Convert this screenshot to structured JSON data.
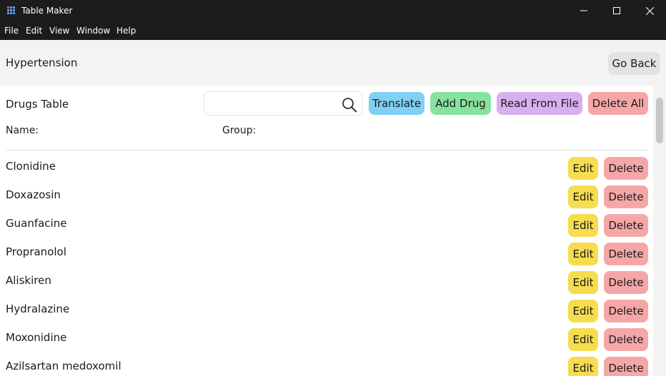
{
  "window": {
    "title": "Table Maker",
    "controls": {
      "minimize_icon": "minimize-icon",
      "maximize_icon": "maximize-icon",
      "close_icon": "close-icon"
    }
  },
  "menu": {
    "items": [
      "File",
      "Edit",
      "View",
      "Window",
      "Help"
    ]
  },
  "header": {
    "title": "Hypertension",
    "go_back_label": "Go Back"
  },
  "table": {
    "title": "Drugs Table",
    "search": {
      "value": "",
      "placeholder": "",
      "icon": "search-icon"
    },
    "actions": {
      "translate": "Translate",
      "add_drug": "Add Drug",
      "read_from_file": "Read From File",
      "delete_all": "Delete All"
    },
    "columns": {
      "name": "Name:",
      "group": "Group:"
    },
    "rows": [
      {
        "name": "Clonidine"
      },
      {
        "name": "Doxazosin"
      },
      {
        "name": "Guanfacine"
      },
      {
        "name": "Propranolol"
      },
      {
        "name": "Aliskiren"
      },
      {
        "name": "Hydralazine"
      },
      {
        "name": "Moxonidine"
      },
      {
        "name": "Azilsartan medoxomil"
      }
    ],
    "row_actions": {
      "edit": "Edit",
      "delete": "Delete"
    }
  },
  "colors": {
    "titlebar_bg": "#1c1c1c",
    "header_bg": "#f3f3f3",
    "translate": "#7fd0f2",
    "add_drug": "#86e29e",
    "read_from_file": "#d7b0ef",
    "delete_all": "#f5a7a7",
    "edit": "#f6dc4f",
    "delete": "#f5a7a7",
    "go_back": "#e3e3e3"
  }
}
